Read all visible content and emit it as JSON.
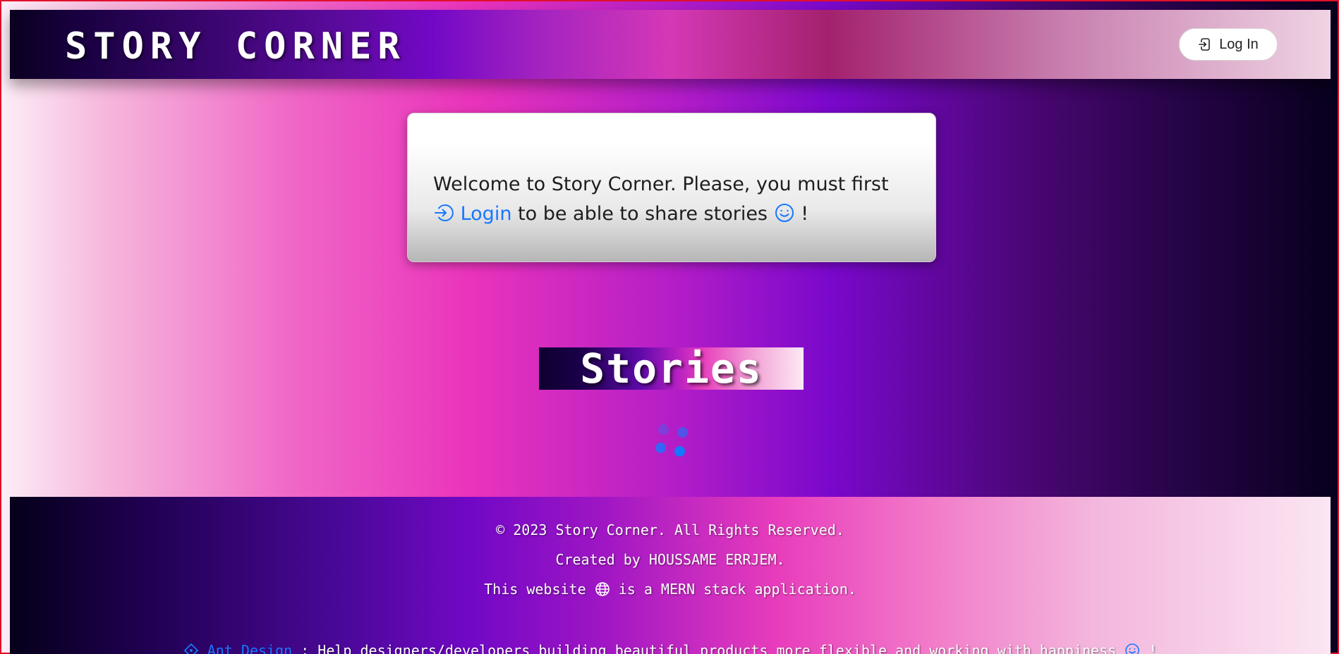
{
  "header": {
    "title": "STORY CORNER",
    "login_label": "Log In"
  },
  "welcome": {
    "text_before": "Welcome to Story Corner. Please, you must first",
    "login_link": "Login",
    "text_after": "to be able to share stories",
    "exclamation": "!"
  },
  "stories": {
    "heading": "Stories"
  },
  "footer": {
    "copyright_symbol": "©",
    "copyright": "2023 Story Corner. All Rights Reserved.",
    "created_by": "Created by HOUSSAME ERRJEM.",
    "website_before": "This website",
    "website_after": "is a MERN stack application.",
    "ant_link": "Ant Design",
    "ant_text": ": Help designers/developers building beautiful products more flexible and working with happiness",
    "ant_end": "!"
  },
  "colors": {
    "accent": "#1677ff",
    "frame_border": "#e0102a"
  }
}
